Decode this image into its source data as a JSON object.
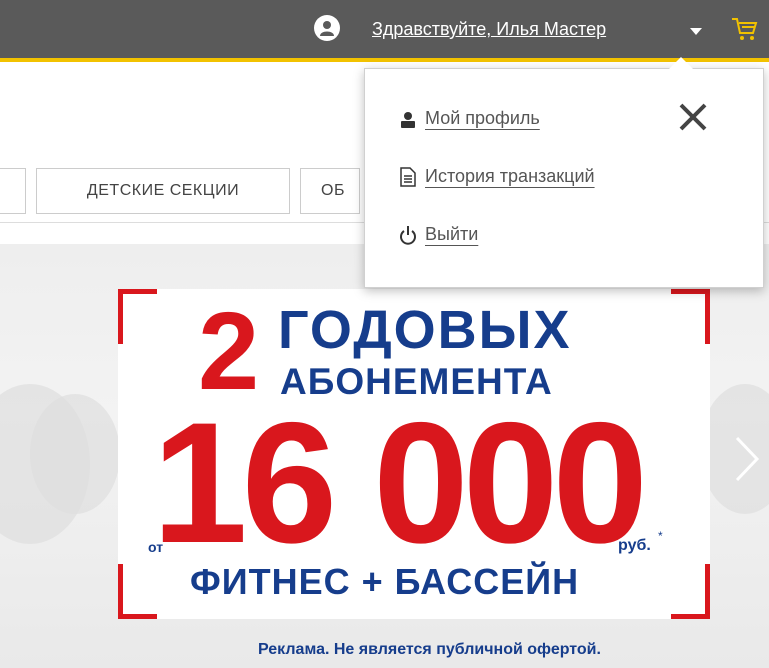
{
  "topbar": {
    "greeting": "Здравствуйте, Илья Мастер",
    "icons": [
      "user-circle-icon",
      "chevron-down-icon",
      "cart-icon"
    ]
  },
  "categories": {
    "items": [
      "ДЕТСКИЕ СЕКЦИИ",
      "ОБ"
    ]
  },
  "user_menu": {
    "items": [
      {
        "label": "Мой профиль",
        "icon": "person-icon"
      },
      {
        "label": "История транзакций",
        "icon": "document-icon"
      },
      {
        "label": "Выйти",
        "icon": "power-icon"
      }
    ],
    "close_icon": "close-icon"
  },
  "banner": {
    "number": "2",
    "line1": "ГОДОВЫХ",
    "line2": "АБОНЕМЕНТА",
    "price_prefix": "от",
    "price": "16 000",
    "currency": "руб.",
    "currency_mark": "*",
    "offer": "ФИТНЕС + БАССЕЙН",
    "disclaimer": "Реклама. Не является публичной офертой.",
    "colors": {
      "red": "#d9171d",
      "blue": "#163d8c"
    },
    "next_icon": "chevron-right-icon"
  },
  "theme": {
    "topbar_bg": "#5a5a5a",
    "accent": "#f2c200"
  }
}
